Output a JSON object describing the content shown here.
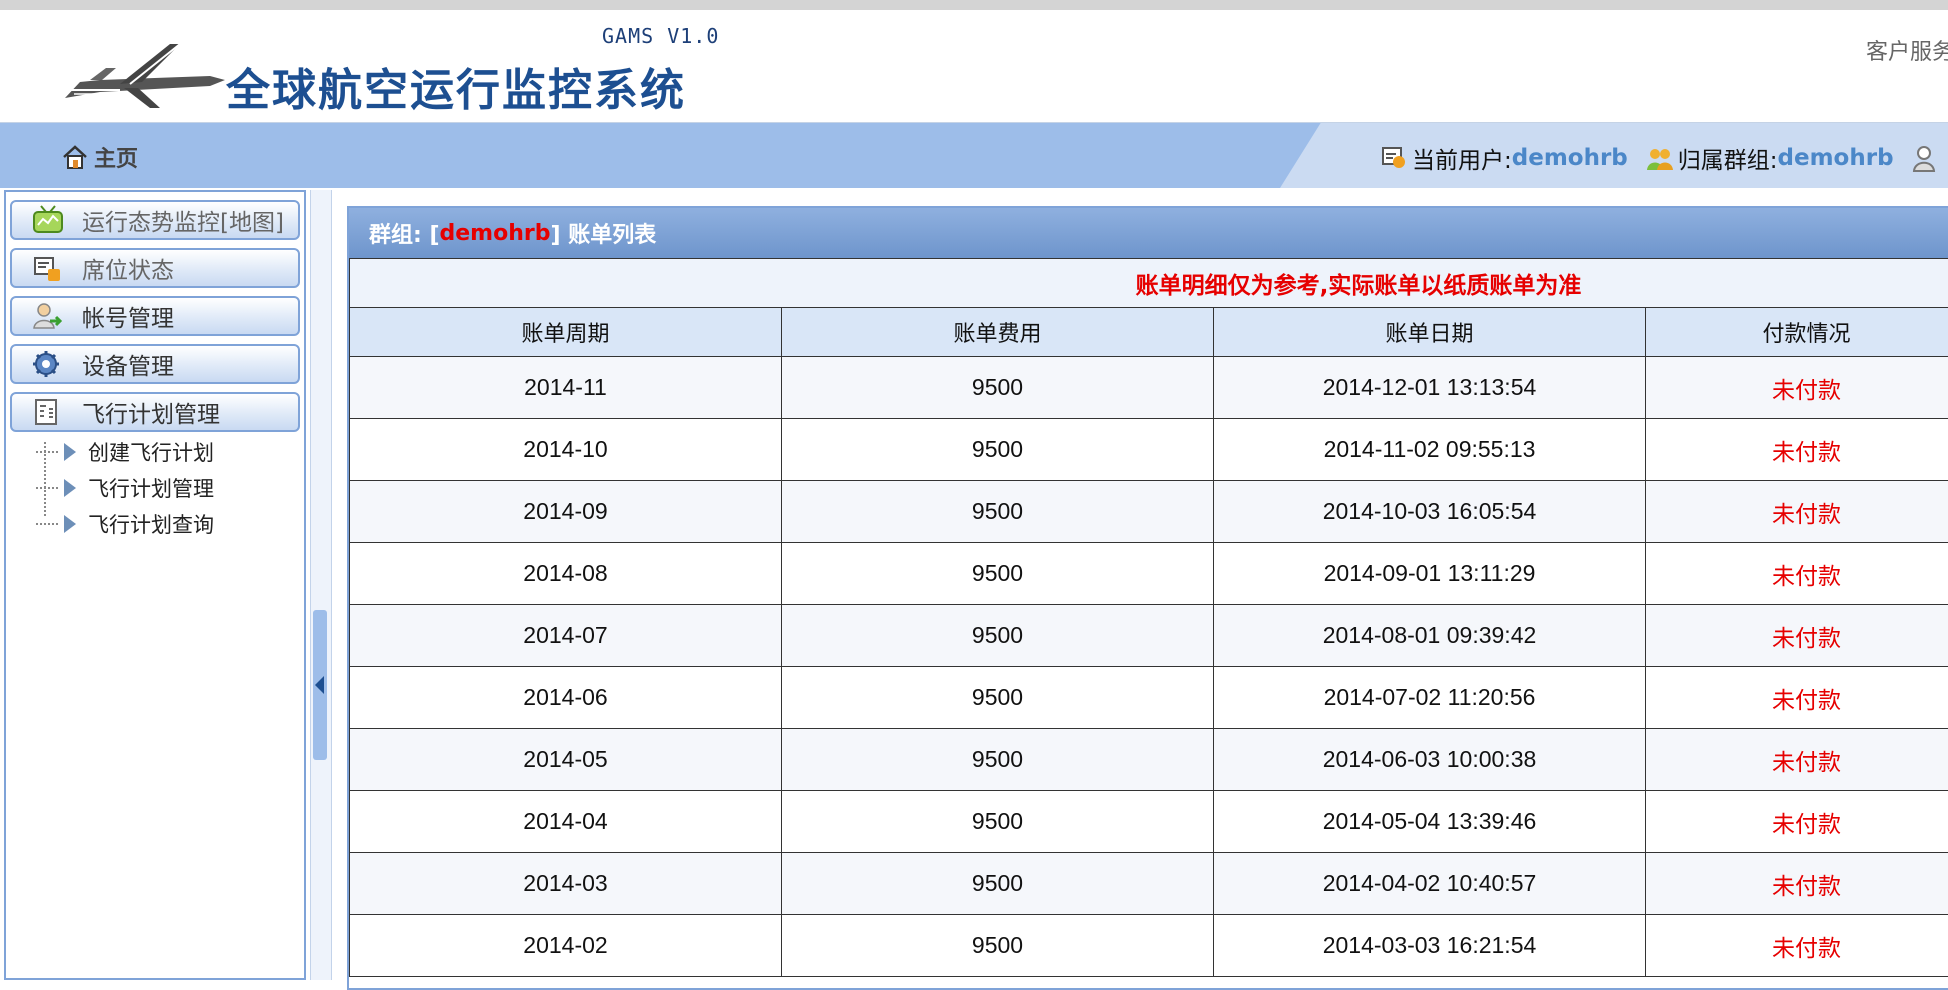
{
  "header": {
    "version": "GAMS V1.0",
    "title": "全球航空运行监控系统",
    "customer_service": "客户服务"
  },
  "nav": {
    "home_label": "主页",
    "current_user_label": "当前用户:",
    "current_user": "demohrb",
    "group_label": "归属群组:",
    "group": "demohrb"
  },
  "sidebar": {
    "items": [
      {
        "label": "运行态势监控[地图]",
        "icon": "monitor-icon"
      },
      {
        "label": "席位状态",
        "icon": "seat-status-icon"
      },
      {
        "label": "帐号管理",
        "icon": "account-icon"
      },
      {
        "label": "设备管理",
        "icon": "device-gear-icon"
      },
      {
        "label": "飞行计划管理",
        "icon": "flight-plan-icon"
      }
    ],
    "subitems": [
      "创建飞行计划",
      "飞行计划管理",
      "飞行计划查询"
    ]
  },
  "panel": {
    "prefix": "群组: [",
    "group": "demohrb",
    "suffix": " ] 账单列表",
    "notice": "账单明细仅为参考,实际账单以纸质账单为准",
    "columns": [
      "账单周期",
      "账单费用",
      "账单日期",
      "付款情况"
    ],
    "rows": [
      {
        "period": "2014-11",
        "fee": "9500",
        "date": "2014-12-01 13:13:54",
        "status": "未付款"
      },
      {
        "period": "2014-10",
        "fee": "9500",
        "date": "2014-11-02 09:55:13",
        "status": "未付款"
      },
      {
        "period": "2014-09",
        "fee": "9500",
        "date": "2014-10-03 16:05:54",
        "status": "未付款"
      },
      {
        "period": "2014-08",
        "fee": "9500",
        "date": "2014-09-01 13:11:29",
        "status": "未付款"
      },
      {
        "period": "2014-07",
        "fee": "9500",
        "date": "2014-08-01 09:39:42",
        "status": "未付款"
      },
      {
        "period": "2014-06",
        "fee": "9500",
        "date": "2014-07-02 11:20:56",
        "status": "未付款"
      },
      {
        "period": "2014-05",
        "fee": "9500",
        "date": "2014-06-03 10:00:38",
        "status": "未付款"
      },
      {
        "period": "2014-04",
        "fee": "9500",
        "date": "2014-05-04 13:39:46",
        "status": "未付款"
      },
      {
        "period": "2014-03",
        "fee": "9500",
        "date": "2014-04-02 10:40:57",
        "status": "未付款"
      },
      {
        "period": "2014-02",
        "fee": "9500",
        "date": "2014-03-03 16:21:54",
        "status": "未付款"
      }
    ]
  },
  "colors": {
    "brand_blue": "#1d4f91",
    "nav_blue": "#9dbde9",
    "alert_red": "#e60000",
    "link_blue": "#4b87c8"
  }
}
